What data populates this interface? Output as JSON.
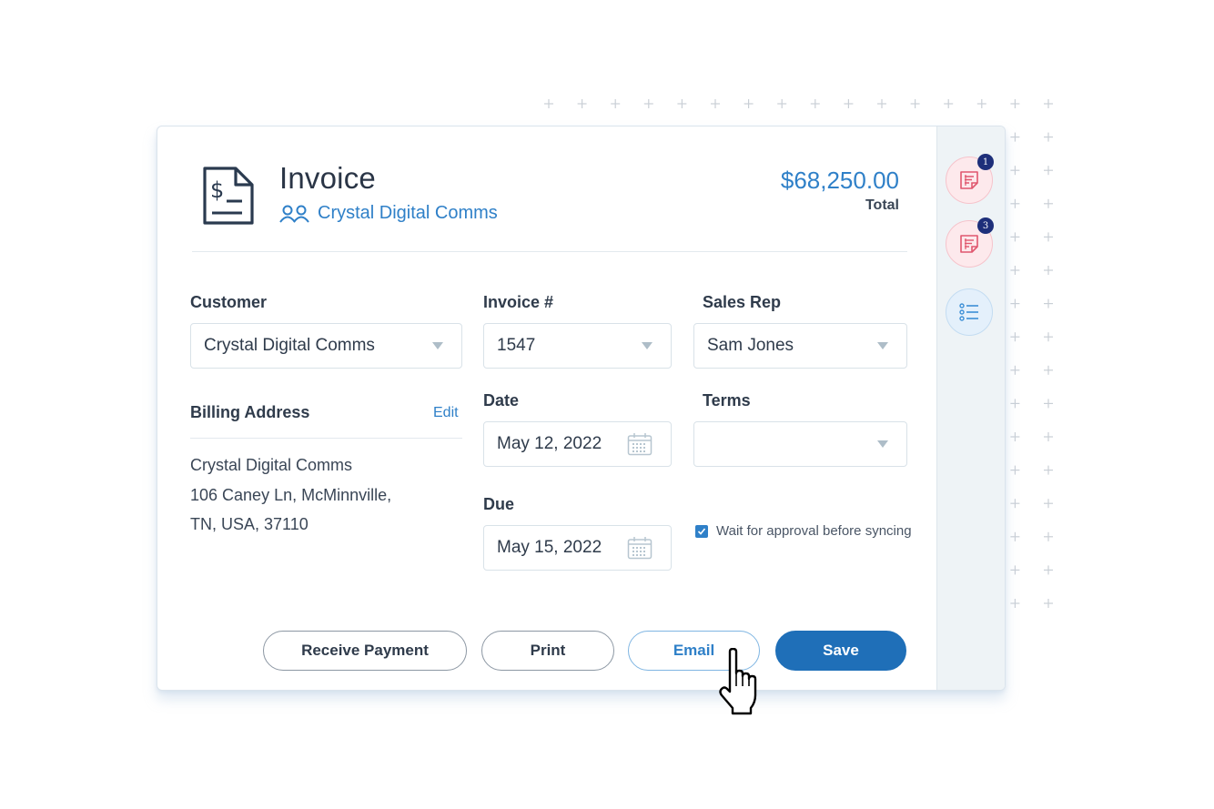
{
  "invoice": {
    "title": "Invoice",
    "customer_link": "Crystal Digital Comms",
    "total_amount": "$68,250.00",
    "total_label": "Total"
  },
  "form": {
    "customer": {
      "label": "Customer",
      "value": "Crystal Digital Comms"
    },
    "invoice_number": {
      "label": "Invoice #",
      "value": "1547"
    },
    "sales_rep": {
      "label": "Sales Rep",
      "value": "Sam Jones"
    },
    "date": {
      "label": "Date",
      "value": "May 12, 2022"
    },
    "terms": {
      "label": "Terms",
      "value": ""
    },
    "due": {
      "label": "Due",
      "value": "May 15, 2022"
    },
    "billing": {
      "label": "Billing Address",
      "edit_label": "Edit",
      "lines": [
        "Crystal Digital Comms",
        "106 Caney Ln, McMinnville,",
        "TN, USA, 37110"
      ]
    },
    "approval_checkbox": {
      "label": "Wait for approval before syncing",
      "checked": true
    }
  },
  "actions": {
    "receive_payment": "Receive Payment",
    "print": "Print",
    "email": "Email",
    "save": "Save"
  },
  "side_rail": {
    "items": [
      {
        "icon": "note-icon",
        "badge": "1"
      },
      {
        "icon": "note-icon",
        "badge": "3"
      },
      {
        "icon": "list-icon",
        "badge": null
      }
    ]
  },
  "colors": {
    "accent": "#2f80c8",
    "primary_button": "#1f6fb8",
    "badge": "#1e2f7a",
    "rail_red": "#fde9ec",
    "rail_blue": "#e4f0fb"
  }
}
